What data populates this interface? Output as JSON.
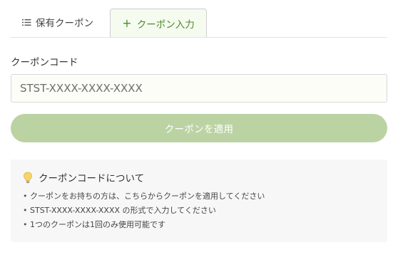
{
  "tabs": {
    "owned_label": "保有クーポン",
    "enter_label": "クーポン入力"
  },
  "form": {
    "label": "クーポンコード",
    "placeholder": "STST-XXXX-XXXX-XXXX",
    "value": "",
    "button_label": "クーポンを適用"
  },
  "info": {
    "title": "クーポンコードについて",
    "items": [
      "クーポンをお持ちの方は、こちらからクーポンを適用してください",
      "STST-XXXX-XXXX-XXXX の形式で入力してください",
      "1つのクーポンは1回のみ使用可能です"
    ]
  },
  "icons": {
    "owned_tab": "list-icon",
    "enter_tab": "plus-icon",
    "info_title": "lightbulb-icon"
  },
  "colors": {
    "accent_green": "#4e8a2a",
    "button_disabled_green": "#bbd3a3",
    "active_tab_bg": "#f5fbef",
    "info_bg": "#f7f7f7"
  }
}
